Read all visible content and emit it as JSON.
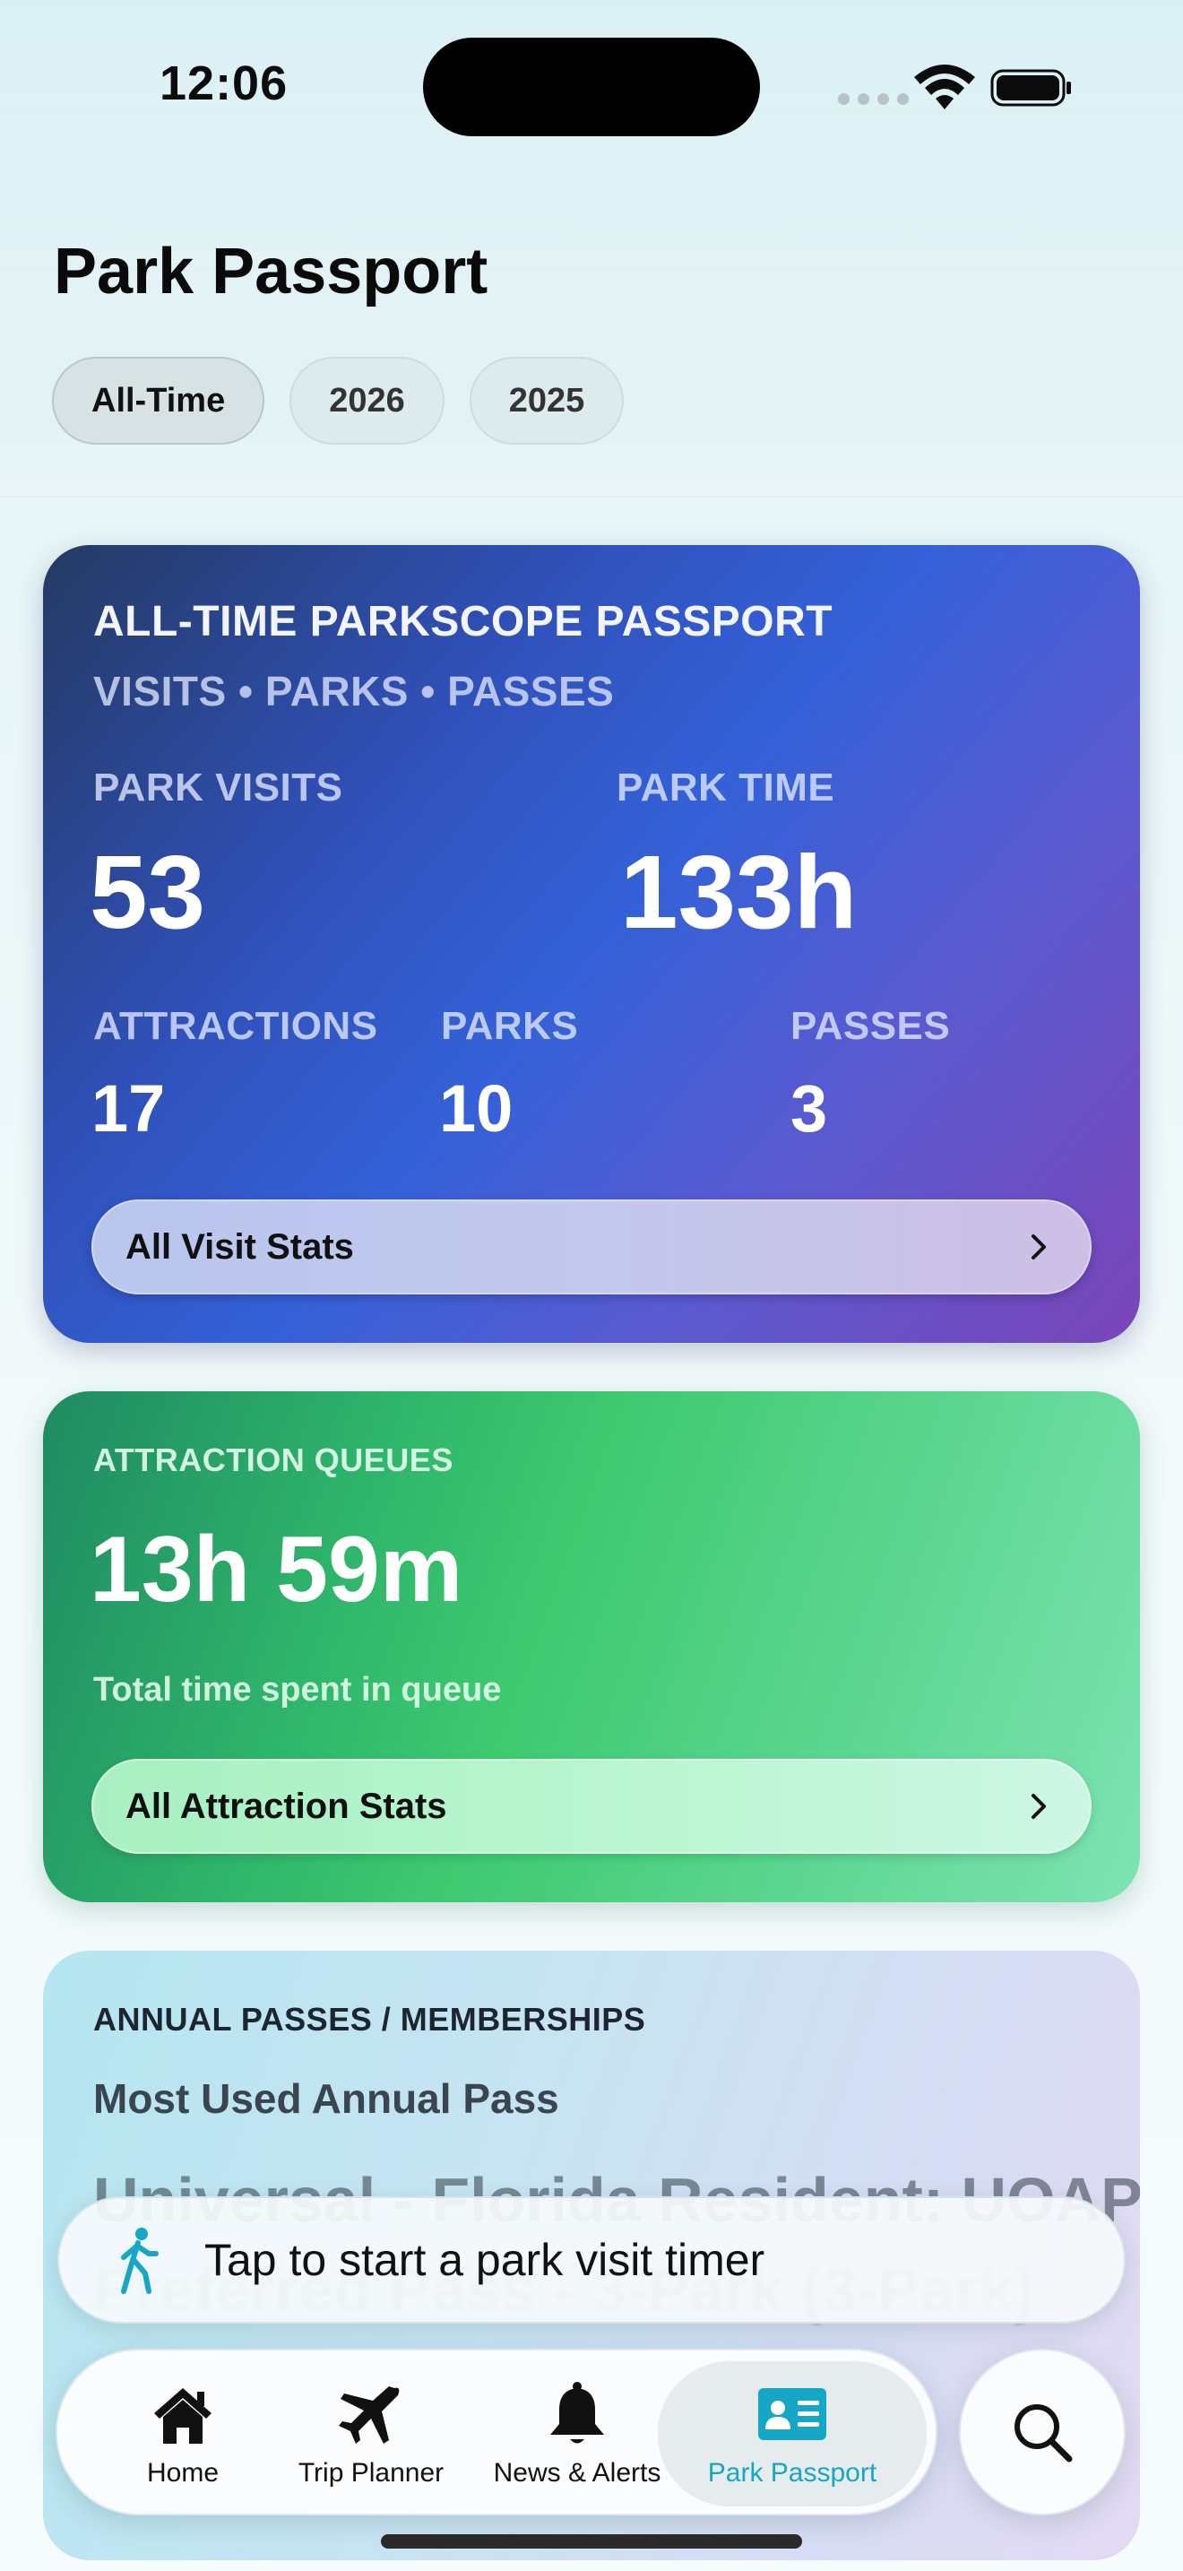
{
  "status_bar": {
    "time": "12:06"
  },
  "header": {
    "title": "Park Passport",
    "filters": [
      {
        "label": "All-Time",
        "active": true
      },
      {
        "label": "2026",
        "active": false
      },
      {
        "label": "2025",
        "active": false
      }
    ]
  },
  "visits_card": {
    "title": "ALL-TIME PARKSCOPE PASSPORT",
    "subtitle": "VISITS • PARKS • PASSES",
    "park_visits_label": "PARK VISITS",
    "park_visits_value": "53",
    "park_time_label": "PARK TIME",
    "park_time_value": "133h",
    "attractions_label": "ATTRACTIONS",
    "attractions_value": "17",
    "parks_label": "PARKS",
    "parks_value": "10",
    "passes_label": "PASSES",
    "passes_value": "3",
    "button_label": "All Visit Stats"
  },
  "queues_card": {
    "title": "ATTRACTION QUEUES",
    "value": "13h 59m",
    "subtitle": "Total time spent in queue",
    "button_label": "All Attraction Stats"
  },
  "passes_card": {
    "title": "ANNUAL PASSES / MEMBERSHIPS",
    "subtitle": "Most Used Annual Pass",
    "pass_name": "Universal - Florida Resident: UOAP",
    "pass_type": "Preferred Pass - 3-Park (3-Park)"
  },
  "timer_bar": {
    "text": "Tap to start a park visit timer"
  },
  "tabbar": {
    "items": [
      {
        "label": "Home",
        "icon": "house-icon"
      },
      {
        "label": "Trip Planner",
        "icon": "airplane-icon"
      },
      {
        "label": "News & Alerts",
        "icon": "bell-icon"
      },
      {
        "label": "Park Passport",
        "icon": "id-card-icon",
        "active": true
      }
    ]
  },
  "colors": {
    "accent": "#16a6c6",
    "visits_card_mid": "#3461d8",
    "queues_card_mid": "#3ec970"
  }
}
